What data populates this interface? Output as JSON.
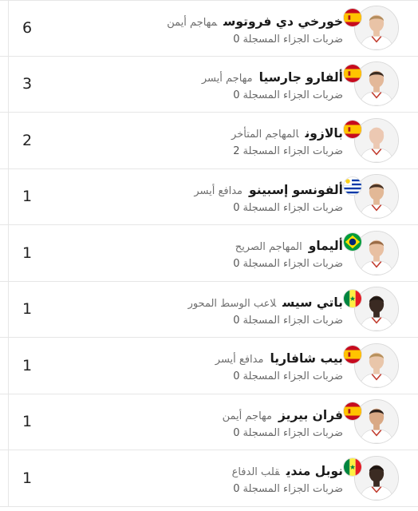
{
  "stat_label": "ضربات الجزاء المسجلة",
  "players": [
    {
      "name": "خورخي دي فروتوس",
      "position": "مهاجم أيمن",
      "penalties": "0",
      "count": "6",
      "flag": "spain",
      "skin": "#e9c3a6",
      "hair": "#b48d5e",
      "shirt": "#ffffff"
    },
    {
      "name": "ألفارو جارسيا",
      "position": "مهاجم أيسر",
      "penalties": "0",
      "count": "3",
      "flag": "spain",
      "skin": "#e3b899",
      "hair": "#3b2b20",
      "shirt": "#ffffff"
    },
    {
      "name": "بالازون",
      "position": "المهاجم المتأخر",
      "penalties": "2",
      "count": "2",
      "flag": "spain",
      "skin": "#ecc8b2",
      "hair": "#ecc8b2",
      "shirt": "#ffffff"
    },
    {
      "name": "ألفونسو إسبينو",
      "position": "مدافع أيسر",
      "penalties": "0",
      "count": "1",
      "flag": "uruguay",
      "skin": "#e2b896",
      "hair": "#4a3425",
      "shirt": "#ffffff"
    },
    {
      "name": "أليماو",
      "position": "المهاجم الصريح",
      "penalties": "0",
      "count": "1",
      "flag": "brazil",
      "skin": "#e8c0a2",
      "hair": "#9a6b45",
      "shirt": "#ffffff"
    },
    {
      "name": "باتي سيس",
      "position": "لاعب الوسط المحور",
      "penalties": "0",
      "count": "1",
      "flag": "senegal",
      "skin": "#3a2a22",
      "hair": "#1e1612",
      "shirt": "#ffffff"
    },
    {
      "name": "بيب شافاريا",
      "position": "مدافع أيسر",
      "penalties": "0",
      "count": "1",
      "flag": "spain",
      "skin": "#e9c6aa",
      "hair": "#b8915d",
      "shirt": "#ffffff"
    },
    {
      "name": "فران بيريز",
      "position": "مهاجم أيمن",
      "penalties": "0",
      "count": "1",
      "flag": "spain",
      "skin": "#d9a985",
      "hair": "#2b201a",
      "shirt": "#ffffff"
    },
    {
      "name": "نوبل مندي",
      "position": "قلب الدفاع",
      "penalties": "0",
      "count": "1",
      "flag": "senegal",
      "skin": "#3b2b22",
      "hair": "#1c1410",
      "shirt": "#ffffff"
    }
  ]
}
